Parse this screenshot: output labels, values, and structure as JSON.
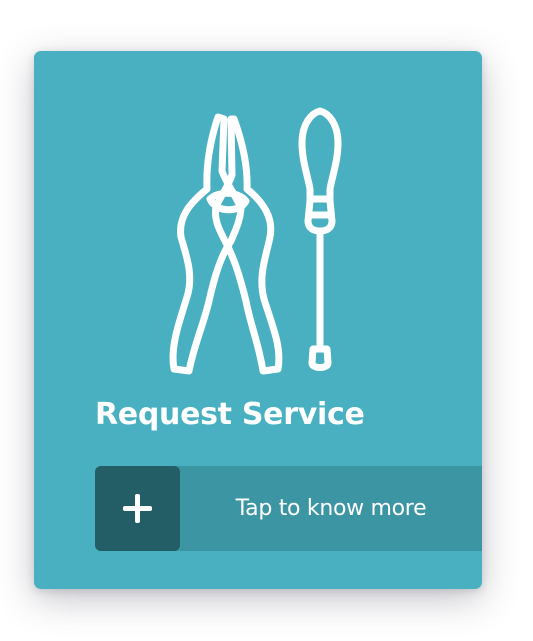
{
  "card": {
    "title": "Request Service",
    "icon": "pliers-and-screwdriver-icon",
    "background_color": "#48b0c0"
  },
  "cta": {
    "label": "Tap to know more",
    "icon": "plus-icon",
    "bar_color": "#3b95a2",
    "button_color": "#235d66"
  }
}
